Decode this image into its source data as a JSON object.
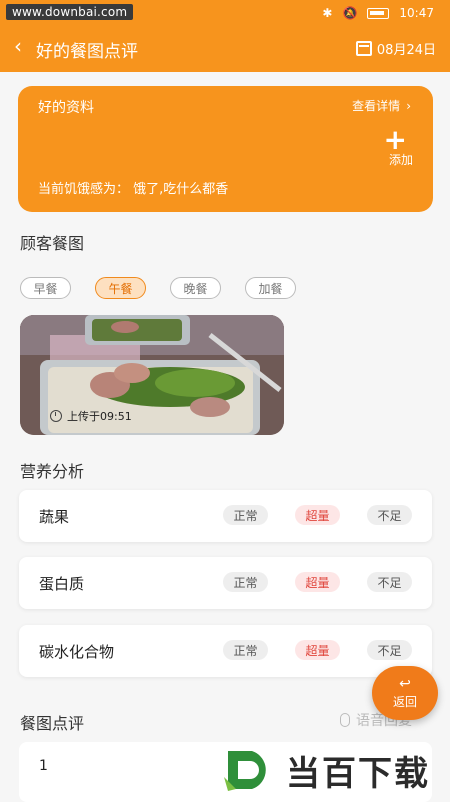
{
  "status_bar": {
    "watermark": "www.downbai.com",
    "time": "10:47"
  },
  "nav": {
    "title": "好的餐图点评",
    "date": "08月24日"
  },
  "profile": {
    "title": "好的资料",
    "detail_link": "查看详情",
    "add_label": "添加",
    "hunger_text": "当前饥饿感为： 饿了,吃什么都香"
  },
  "customer_meals": {
    "title": "顾客餐图",
    "tabs": [
      {
        "label": "早餐",
        "active": false
      },
      {
        "label": "午餐",
        "active": true
      },
      {
        "label": "晚餐",
        "active": false
      },
      {
        "label": "加餐",
        "active": false
      }
    ],
    "upload_time": "上传于09:51"
  },
  "nutrition": {
    "title": "营养分析",
    "rows": [
      {
        "name": "蔬果",
        "normal": "正常",
        "over": "超量",
        "under": "不足"
      },
      {
        "name": "蛋白质",
        "normal": "正常",
        "over": "超量",
        "under": "不足"
      },
      {
        "name": "碳水化合物",
        "normal": "正常",
        "over": "超量",
        "under": "不足"
      }
    ]
  },
  "review": {
    "title": "餐图点评",
    "voice_reply": "语音回复",
    "comment": "1"
  },
  "return_button": {
    "label": "返回"
  },
  "brand_watermark": "当百下载",
  "colors": {
    "accent": "#f7941d",
    "danger": "#e0453c"
  }
}
